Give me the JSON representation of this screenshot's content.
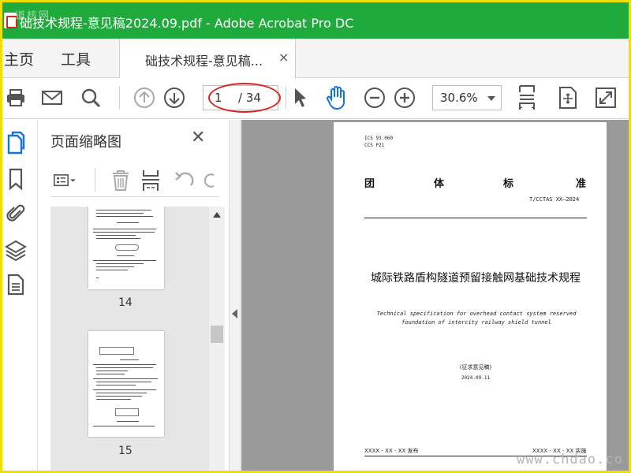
{
  "window": {
    "title": "础技术规程-意见稿2024.09.pdf - Adobe Acrobat Pro DC",
    "watermark": "道核网"
  },
  "menu": {
    "home": "主页",
    "tools": "工具"
  },
  "tab": {
    "label": "础技术规程-意见稿...",
    "close": "×"
  },
  "toolbar": {
    "icons": [
      "print-icon",
      "mail-icon",
      "search-icon",
      "page-up-icon",
      "page-down-icon",
      "select-arrow-icon",
      "hand-icon",
      "zoom-out-icon",
      "zoom-in-icon",
      "fit-page-icon",
      "full-screen-icon",
      "expand-icon"
    ],
    "current_page": "1",
    "total_pages": "/ 34",
    "zoom": "30.6%"
  },
  "sidebar_rail": {
    "icons": [
      "pages-icon",
      "bookmark-icon",
      "attachment-icon",
      "layers-icon",
      "document-icon"
    ]
  },
  "thumbnails_panel": {
    "title": "页面缩略图",
    "close": "✕",
    "tools": [
      "options-icon",
      "delete-icon",
      "insert-page-icon",
      "undo-icon",
      "rotate-icon"
    ],
    "pages": [
      {
        "number": "14"
      },
      {
        "number": "15"
      }
    ]
  },
  "document": {
    "ics": "ICS  93.060",
    "ccs": "CCS  P21",
    "heading_chars": [
      "团",
      "体",
      "标",
      "准"
    ],
    "code": "T/CCTAS XX—2024",
    "title": "城际铁路盾构隧道预留接触网基础技术规程",
    "english_title": "Technical specification for overhead contact system reserved foundation of intercity railway shield tunnel",
    "draft": "(征求意见稿)",
    "date": "2024.09.11",
    "publish": "XXXX - XX - XX 发布",
    "implement": "XXXX - XX - XX 实施"
  },
  "site_watermark": "www.chdao.co",
  "colors": {
    "titlebar": "#1eab3b",
    "frame": "#f0e000",
    "annotation": "#e02020",
    "hand_tool": "#1473e6",
    "canvas": "#9a9a9a"
  }
}
